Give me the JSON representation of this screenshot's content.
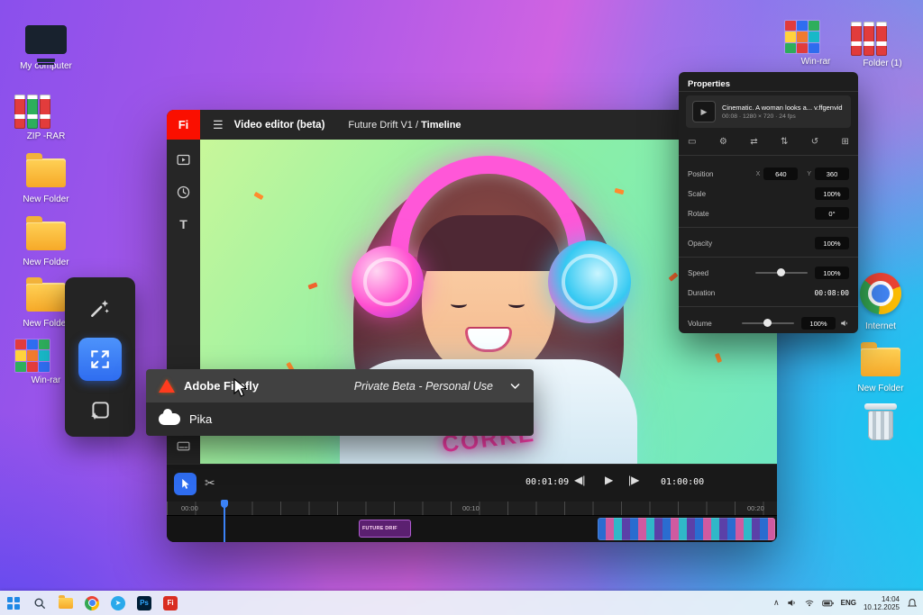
{
  "desktop": {
    "left_icons": [
      {
        "label": "My computer"
      },
      {
        "label": "ZIP -RAR"
      },
      {
        "label": "New Folder"
      },
      {
        "label": "New Folder"
      },
      {
        "label": "New Folder"
      },
      {
        "label": "Win-rar"
      }
    ],
    "right_top": [
      {
        "label": "Win-rar"
      },
      {
        "label": "Folder (1)"
      }
    ],
    "right_mid": [
      {
        "label": "Internet"
      },
      {
        "label": "New Folder"
      },
      {
        "label": ""
      }
    ]
  },
  "editor": {
    "logo": "Fi",
    "title": "Video editor (beta)",
    "project": "Future Drift V1",
    "sep": "/",
    "page": "Timeline",
    "sidebar": {
      "text_tool": "T"
    },
    "glyphs": {
      "menu": "☰",
      "scissors": "✂",
      "prev": "◀|",
      "play": "▶",
      "next": "|▶"
    },
    "dropdown": {
      "items": [
        {
          "label": "Adobe Firefly",
          "badge": "Private Beta - Personal Use"
        },
        {
          "label": "Pika",
          "badge": ""
        }
      ]
    },
    "timeline": {
      "current": "00:01:09",
      "total": "01:00:00",
      "ruler": [
        "00:00",
        "00:10",
        "00:20"
      ],
      "clip": "FUTURE DRIF"
    }
  },
  "preview": {
    "shirt_text": "CORKE"
  },
  "properties": {
    "title": "Properties",
    "clip_name": "Cinematic. A woman looks a... v.ffgenvid",
    "clip_meta": "00:08 · 1280 × 720 · 24 fps",
    "position": {
      "label": "Position",
      "x_label": "X",
      "x": "640",
      "y_label": "Y",
      "y": "360"
    },
    "scale": {
      "label": "Scale",
      "value": "100%"
    },
    "rotate": {
      "label": "Rotate",
      "value": "0°"
    },
    "opacity": {
      "label": "Opacity",
      "value": "100%"
    },
    "speed": {
      "label": "Speed",
      "value": "100%"
    },
    "duration": {
      "label": "Duration",
      "value": "00:08:00"
    },
    "volume": {
      "label": "Volume",
      "value": "100%"
    }
  },
  "taskbar": {
    "lang": "ENG",
    "time": "14:04",
    "date": "10.12.2025",
    "ps": "Ps",
    "fi": "Fi"
  }
}
